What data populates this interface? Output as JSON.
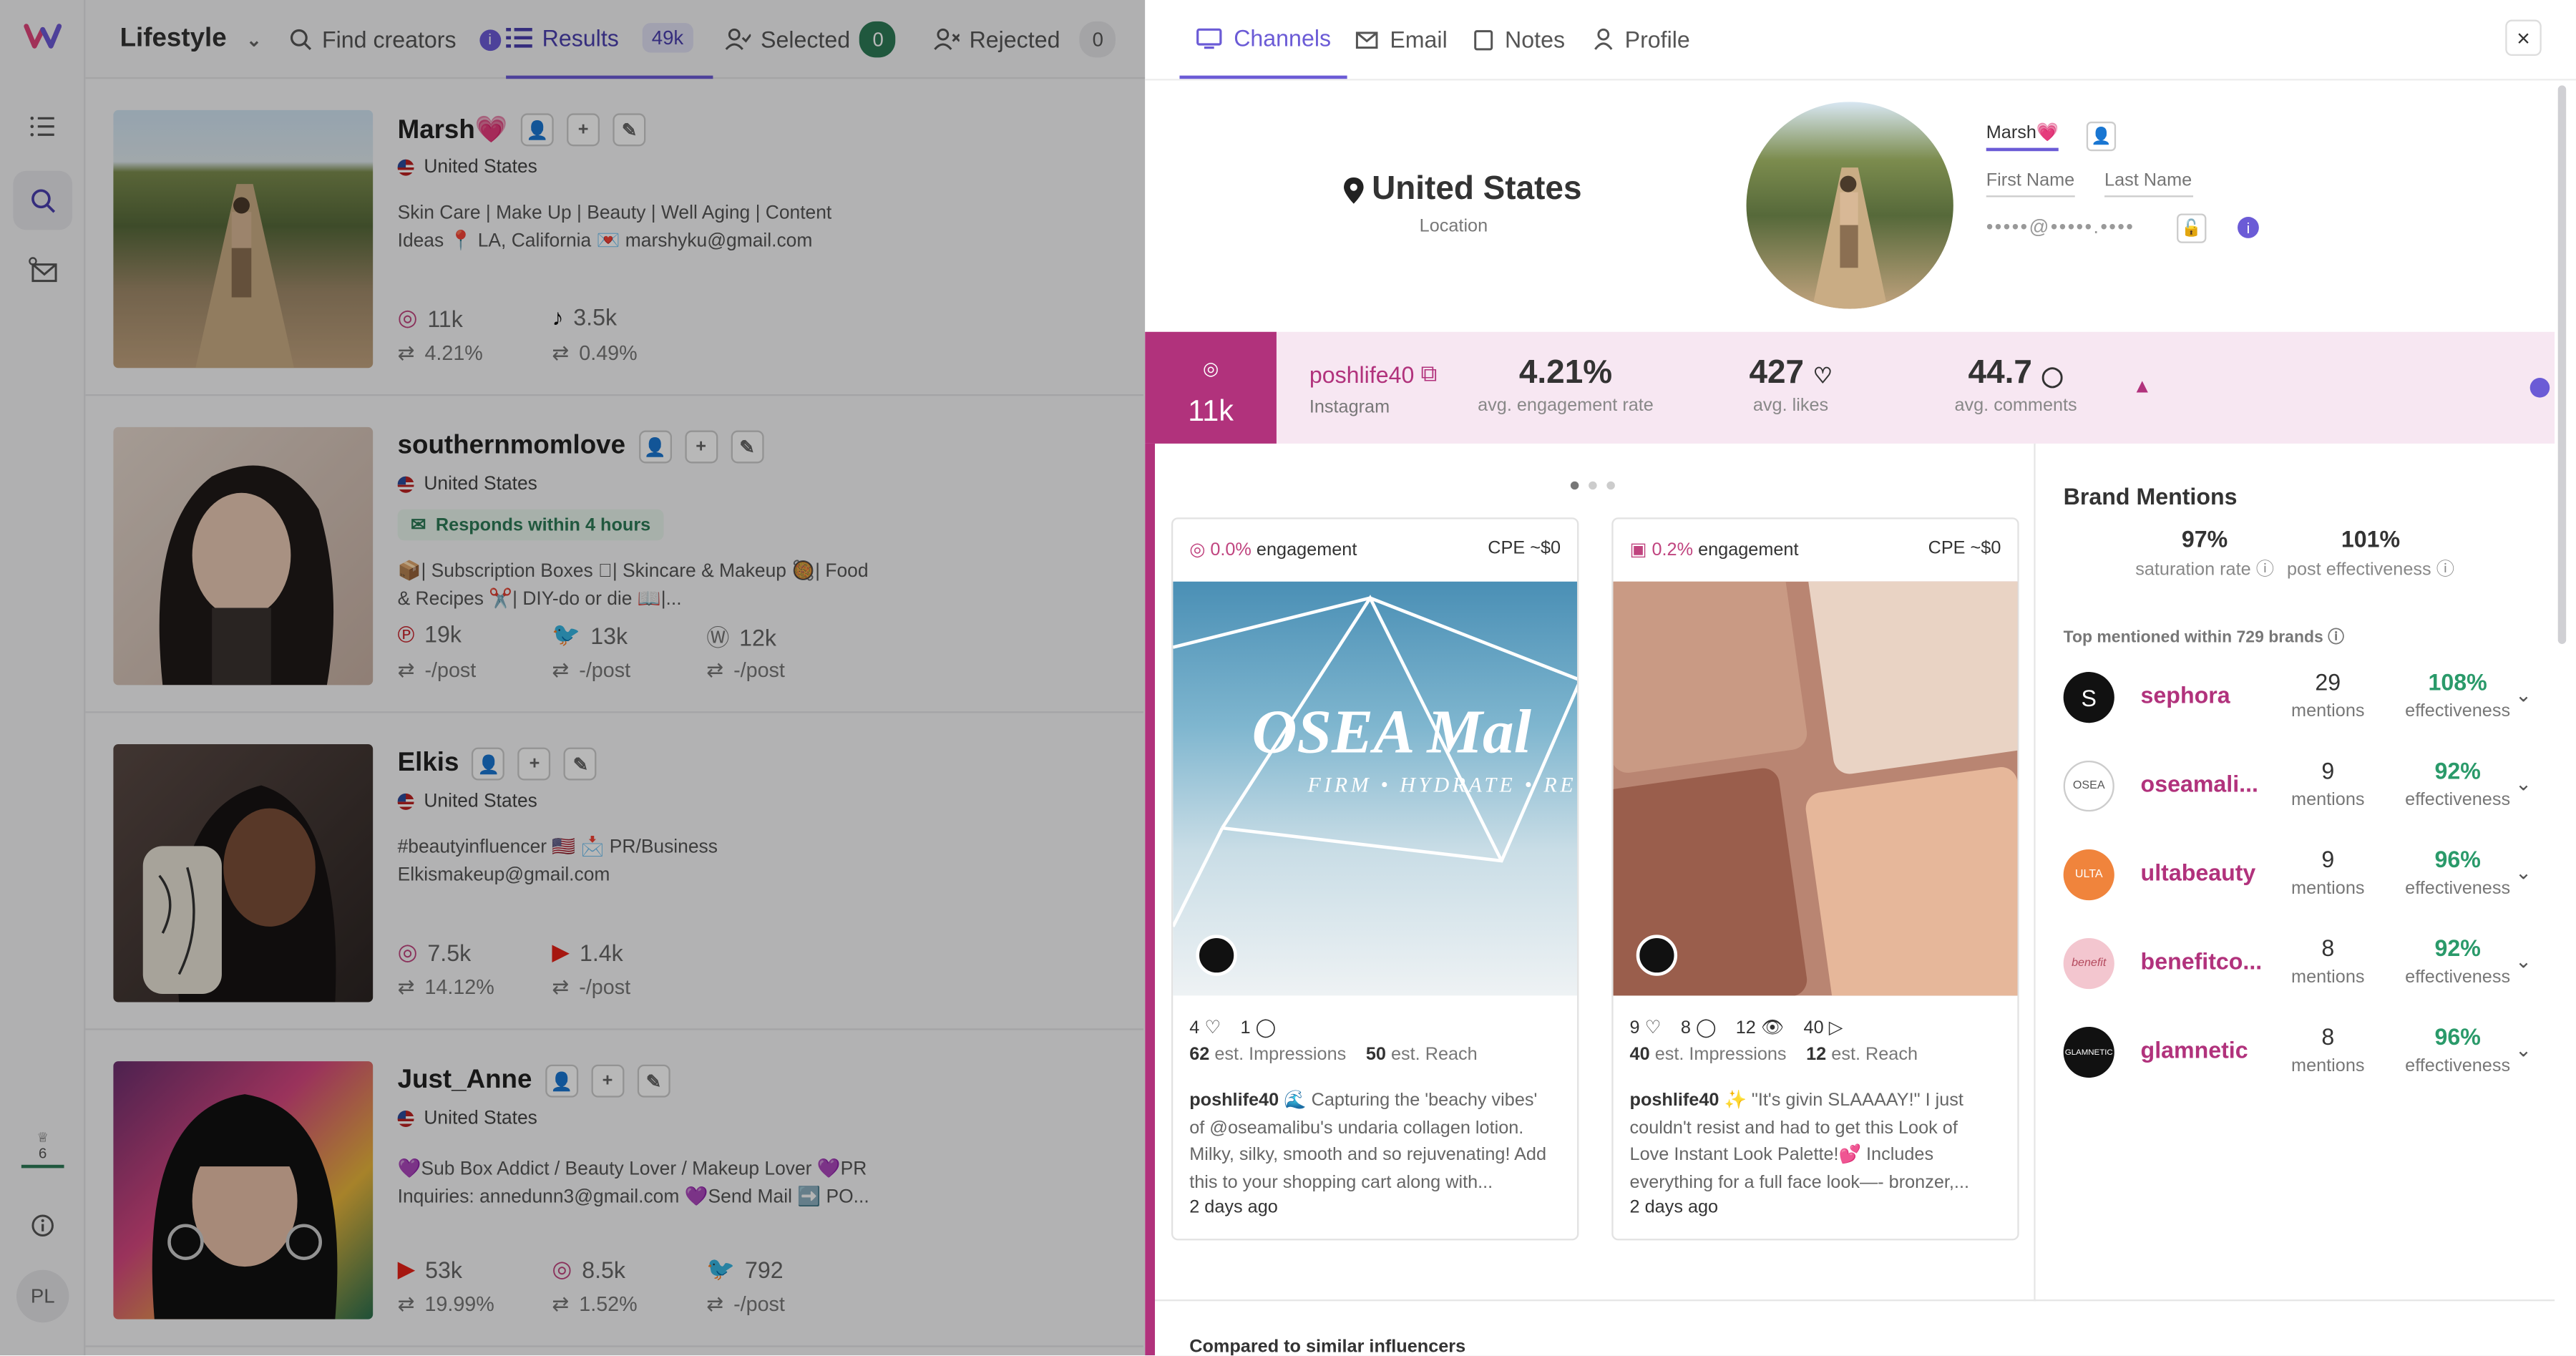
{
  "app": {
    "workspace": "Lifestyle",
    "user_initials": "PL",
    "rail_badge": "6"
  },
  "topbar": {
    "find": "Find creators",
    "results": "Results",
    "results_count": "49k",
    "selected": "Selected",
    "selected_count": "0",
    "rejected": "Rejected",
    "rejected_count": "0"
  },
  "creators": [
    {
      "name": "Marsh💗",
      "country": "United States",
      "bio": "Skin Care | Make Up | Beauty | Well Aging | Content Ideas 📍 LA, California 💌 marshyku@gmail.com",
      "s1": "11k",
      "s1b": "4.21%",
      "s2": "3.5k",
      "s2b": "0.49%"
    },
    {
      "name": "southernmomlove",
      "country": "United States",
      "response": "Responds within 4 hours",
      "bio": "📦| Subscription Boxes 🏻| Skincare & Makeup 🥘| Food & Recipes ✂️| DIY-do or die 📖|...",
      "s1": "19k",
      "s1b": "-/post",
      "s2": "13k",
      "s2b": "-/post",
      "s3": "12k",
      "s3b": "-/post"
    },
    {
      "name": "Elkis",
      "country": "United States",
      "bio": "#beautyinfluencer 🇺🇸 📩 PR/Business Elkismakeup@gmail.com",
      "s1": "7.5k",
      "s1b": "14.12%",
      "s2": "1.4k",
      "s2b": "-/post"
    },
    {
      "name": "Just_Anne",
      "country": "United States",
      "bio": "💜Sub Box Addict / Beauty Lover / Makeup Lover 💜PR Inquiries: annedunn3@gmail.com 💜Send Mail ➡️ PO...",
      "s1": "53k",
      "s1b": "19.99%",
      "s2": "8.5k",
      "s2b": "1.52%",
      "s3": "792",
      "s3b": "-/post"
    }
  ],
  "panel": {
    "tabs": [
      "Channels",
      "Email",
      "Notes",
      "Profile"
    ],
    "close": "×",
    "location": "United States",
    "location_label": "Location",
    "profile_name": "Marsh💗",
    "first_name_placeholder": "First Name",
    "last_name_placeholder": "Last Name",
    "email_masked": "•••••@•••••.••••",
    "channel": {
      "followers": "11k",
      "handle": "poshlife40",
      "platform": "Instagram",
      "eng_rate": "4.21%",
      "eng_label": "avg. engagement rate",
      "likes": "427",
      "likes_label": "avg. likes",
      "comments": "44.7",
      "comments_label": "avg. comments"
    },
    "posts": [
      {
        "eng": "0.0%",
        "eng_label": "engagement",
        "cpe": "CPE ~$0",
        "likes": "4",
        "comments": "1",
        "impressions": "62",
        "imp_label": "est. Impressions",
        "reach": "50",
        "reach_label": "est. Reach",
        "author": "poshlife40",
        "caption": "🌊 Capturing the 'beachy vibes' of @oseamalibu's undaria collagen lotion. Milky, silky, smooth and so rejuvenating! Add this to your shopping cart along with...",
        "ago": "2 days ago",
        "img_text": "OSEA Mal",
        "img_sub": "FIRM • HYDRATE • REV"
      },
      {
        "eng": "0.2%",
        "eng_label": "engagement",
        "cpe": "CPE ~$0",
        "likes": "9",
        "comments": "8",
        "views": "12",
        "plays": "40",
        "impressions": "40",
        "imp_label": "est. Impressions",
        "reach": "12",
        "reach_label": "est. Reach",
        "author": "poshlife40",
        "caption": "✨ \"It's givin SLAAAAY!\" I just couldn't resist and had to get this Look of Love Instant Look Palette!💕 Includes everything for a full face look—- bronzer,...",
        "ago": "2 days ago"
      }
    ],
    "mentions": {
      "title": "Brand Mentions",
      "saturation": "97%",
      "saturation_label": "saturation rate",
      "effectiveness": "101%",
      "effectiveness_label": "post effectiveness",
      "top_label": "Top mentioned within 729 brands",
      "brands": [
        {
          "name": "sephora",
          "count": "29",
          "eff": "108%",
          "logo": "S"
        },
        {
          "name": "oseamali...",
          "count": "9",
          "eff": "92%",
          "logo": "OSEA"
        },
        {
          "name": "ultabeauty",
          "count": "9",
          "eff": "96%",
          "logo": "ULTA"
        },
        {
          "name": "benefitco...",
          "count": "8",
          "eff": "92%",
          "logo": "benefit"
        },
        {
          "name": "glamnetic",
          "count": "8",
          "eff": "96%",
          "logo": "GLAMNETIC"
        }
      ],
      "mentions_label": "mentions",
      "eff_label": "effectiveness"
    },
    "compared": "Compared to similar influencers"
  }
}
